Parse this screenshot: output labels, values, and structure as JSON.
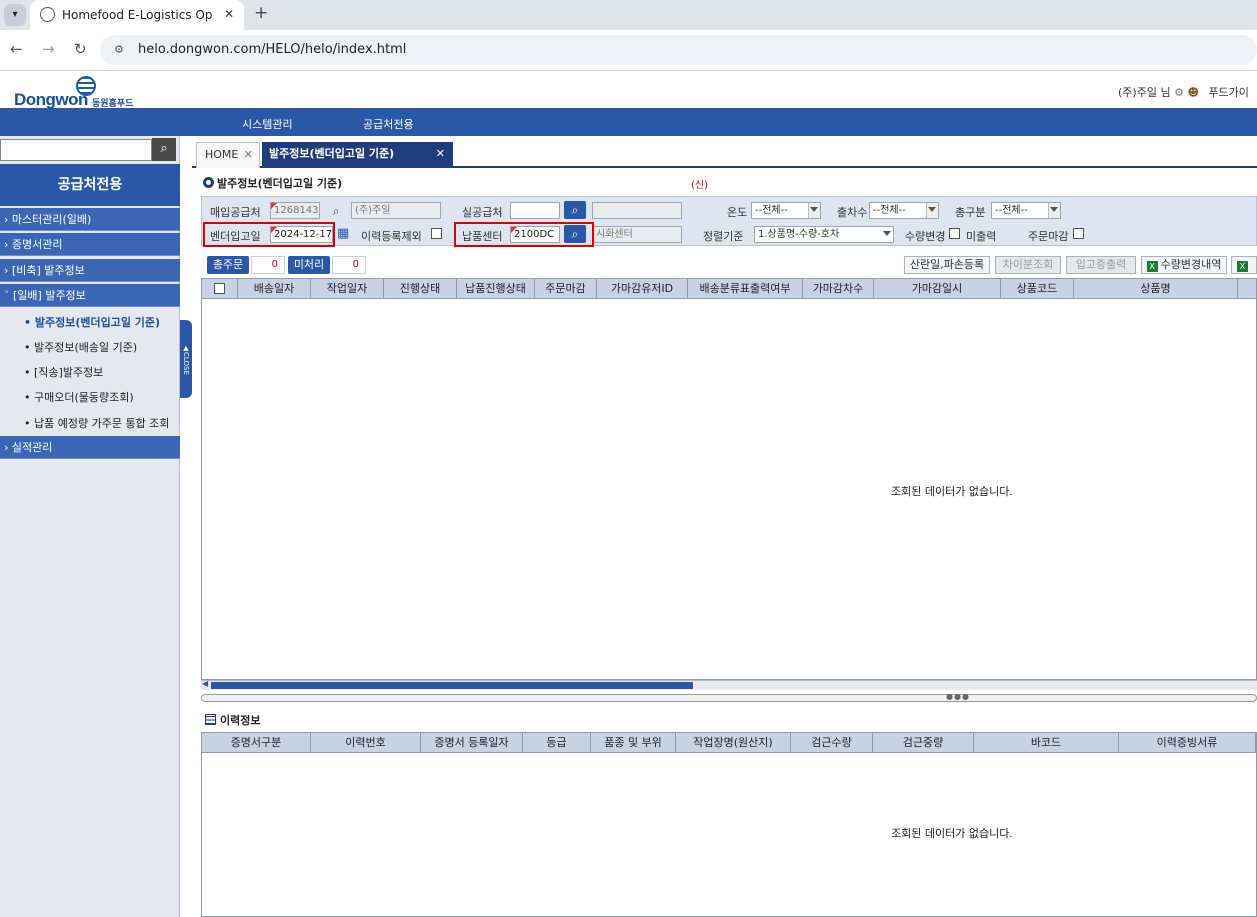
{
  "browser": {
    "tab_title": "Homefood E-Logistics Operati",
    "url": "helo.dongwon.com/HELO/helo/index.html"
  },
  "header": {
    "logo_text": "Dongwon",
    "logo_sub": "동원홈푸드",
    "user": "(주)주일 님",
    "extra": "푸드가이"
  },
  "topnav": [
    "시스템관리",
    "공급처전용"
  ],
  "sidebar": {
    "title": "공급처전용",
    "groups": [
      "마스터관리(일배)",
      "증명서관리",
      "[비축] 발주정보",
      "[일배] 발주정보"
    ],
    "subitems": [
      "발주정보(벤더입고일 기준)",
      "발주정보(배송일 기준)",
      "[직송]발주정보",
      "구매오더(물동량조회)",
      "납품 예정량 가주문 통합 조회"
    ],
    "last_group": "실적관리",
    "close_label": "▲CLOSE"
  },
  "tabs": {
    "home": "HOME",
    "current": "발주정보(벤더입고일 기준)"
  },
  "panel": {
    "title": "발주정보(벤더입고일 기준)",
    "new_label": "(신)"
  },
  "search": {
    "purchase_supplier_label": "매입공급처",
    "purchase_supplier_code": "1268143",
    "purchase_supplier_name": "(주)주일",
    "actual_supplier_label": "실공급처",
    "temp_label": "온도",
    "temp_value": "--전체--",
    "shipments_label": "출차수",
    "shipments_value": "--전체--",
    "kind_label": "총구분",
    "kind_value": "--전체--",
    "vendor_date_label": "벤더입고일",
    "vendor_date_value": "2024-12-17",
    "history_exclude_label": "이력등록제외",
    "center_label": "납품센터",
    "center_code": "2100DC",
    "center_name": "시화센터",
    "sort_label": "정렬기준",
    "sort_value": "1.상품명-수량-호차",
    "qty_change_label": "수량변경",
    "not_shipped_label": "미출력",
    "order_close_label": "주문마감"
  },
  "counters": {
    "total_label": "총주문",
    "total_value": "0",
    "unproc_label": "미처리",
    "unproc_value": "0"
  },
  "actions": [
    "산란일,파손등록",
    "차이분조회",
    "입고증출력",
    "수량변경내역"
  ],
  "order_grid": {
    "columns": [
      "배송일자",
      "작업일자",
      "진행상태",
      "납품진행상태",
      "주문마감",
      "가마감유저ID",
      "배송분류표출력여부",
      "가마감차수",
      "가마감일시",
      "상품코드",
      "상품명"
    ],
    "empty_message": "조회된 데이터가 없습니다."
  },
  "history": {
    "title": "이력정보",
    "columns": [
      "증명서구분",
      "이력번호",
      "증명서 등록일자",
      "등급",
      "품종 및 부위",
      "작업장명(원산지)",
      "검근수량",
      "검근중량",
      "바코드",
      "이력증빙서류"
    ],
    "empty_message": "조회된 데이터가 없습니다."
  },
  "colors": {
    "primary": "#2b57a7",
    "dark_tab": "#1f3d7a",
    "highlight": "#e00000"
  }
}
